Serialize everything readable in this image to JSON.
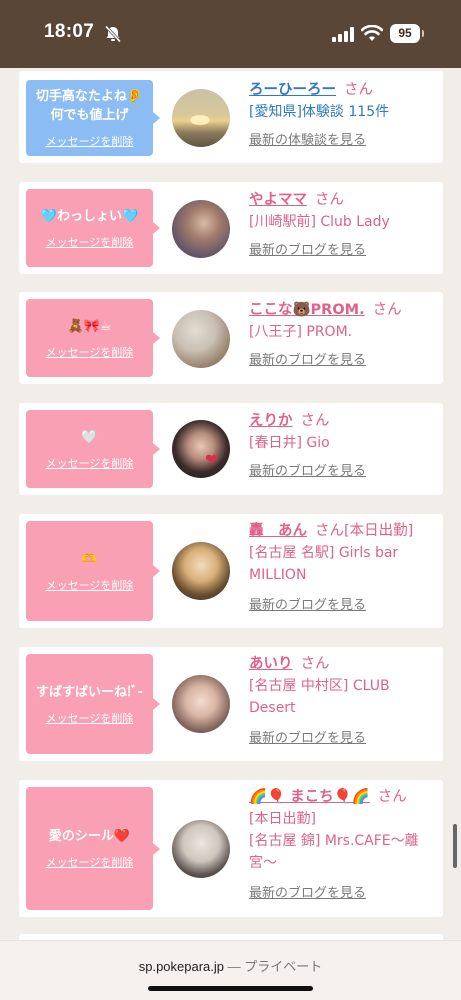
{
  "status": {
    "time": "18:07",
    "battery": "95"
  },
  "delete_label": "メッセージを削除",
  "cards": [
    {
      "message": "切手高なたよね👂\n何でも値上げ",
      "bubble": "blue",
      "name": "ろーひーろー",
      "san": "さん",
      "name_extra": "",
      "shop_lines": [
        "[愛知県]体験談 115件"
      ],
      "link": "最新の体験談を見る",
      "avatar": "sunset-photo"
    },
    {
      "message": "🩵わっしょい🩵",
      "bubble": "pink",
      "name": "やよママ",
      "san": "さん",
      "name_extra": "",
      "shop_lines": [
        "[川崎駅前] Club Lady"
      ],
      "link": "最新のブログを見る",
      "avatar": "woman-photo"
    },
    {
      "message": "🧸🎀☕",
      "bubble": "pink",
      "name": "ここな🐻PROM.",
      "san": "さん",
      "name_extra": "",
      "shop_lines": [
        "[八王子] PROM."
      ],
      "link": "最新のブログを見る",
      "avatar": "woman-dog-photo"
    },
    {
      "message": "🤍",
      "bubble": "pink",
      "name": "えりか",
      "san": "さん",
      "name_extra": "",
      "shop_lines": [
        "[春日井] Gio"
      ],
      "link": "最新のブログを見る",
      "avatar": "woman-heart-photo"
    },
    {
      "message": "🫶",
      "bubble": "pink",
      "name": "轟　あん",
      "san": "さん",
      "name_extra": "[本日出勤]",
      "shop_lines": [
        "[名古屋 名駅] Girls bar",
        "MILLION"
      ],
      "link": "最新のブログを見る",
      "avatar": "blonde-woman-photo"
    },
    {
      "message": "すばすばいーね!ﾞ-",
      "bubble": "pink",
      "name": "あいり",
      "san": "さん",
      "name_extra": "",
      "shop_lines": [
        "[名古屋 中村区] CLUB",
        "Desert"
      ],
      "link": "最新のブログを見る",
      "avatar": "woman-selfie-photo"
    },
    {
      "message": "愛のシール❤️",
      "bubble": "pink",
      "name": "🌈🎈 まこち🎈🌈",
      "san": "さん",
      "name_extra": "",
      "shop_lines": [
        "[本日出勤]",
        "[名古屋 錦] Mrs.CAFE〜離",
        "宮〜"
      ],
      "link": "最新のブログを見る",
      "avatar": "mirror-selfie-photo"
    }
  ],
  "url_bar": {
    "domain": "sp.pokepara.jp",
    "label": "— プライベート"
  }
}
